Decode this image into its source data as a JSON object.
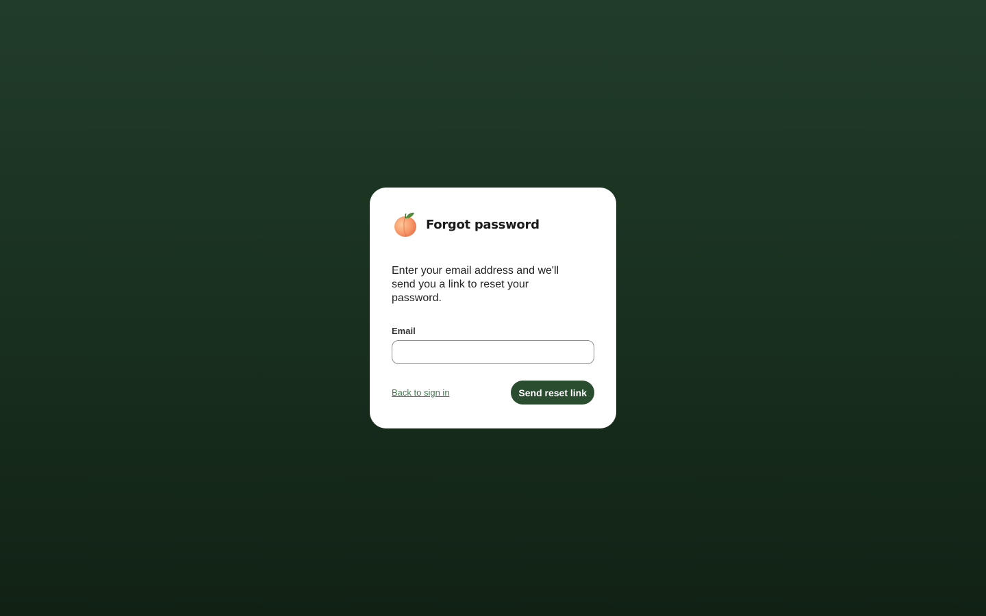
{
  "colors": {
    "background_top": "#213d29",
    "background_bottom": "#112215",
    "card": "#ffffff",
    "accent": "#2a4d30",
    "link": "#3f7a4c"
  },
  "card": {
    "icon": "peach-icon",
    "title": "Forgot password",
    "description": "Enter your email address and we'll send you a link to reset your password."
  },
  "form": {
    "email_label": "Email",
    "email_value": "",
    "email_placeholder": ""
  },
  "actions": {
    "back_link": "Back to sign in",
    "submit_label": "Send reset link"
  }
}
